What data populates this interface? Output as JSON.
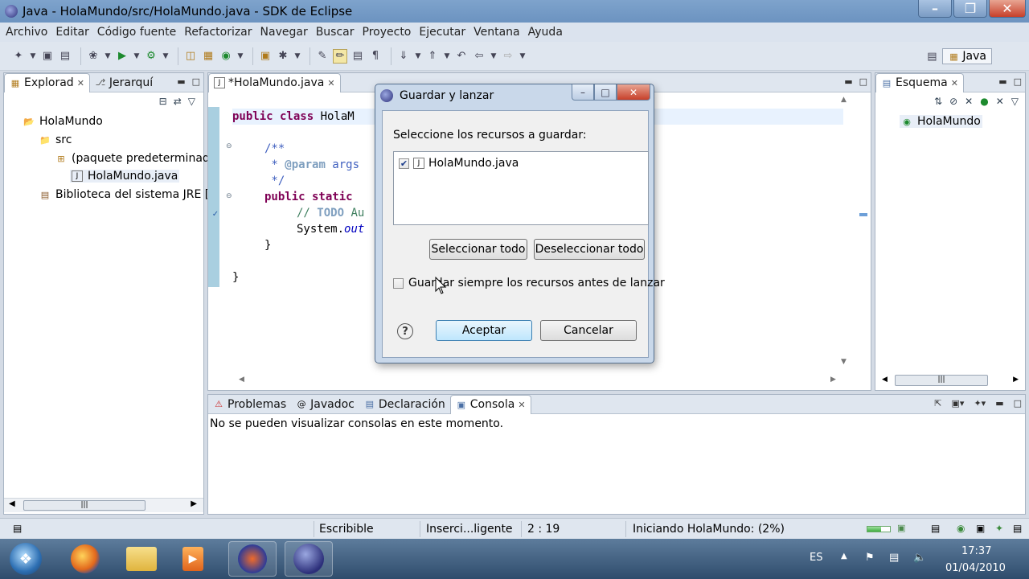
{
  "window": {
    "title": "Java - HolaMundo/src/HolaMundo.java - SDK de Eclipse"
  },
  "menu": [
    "Archivo",
    "Editar",
    "Código fuente",
    "Refactorizar",
    "Navegar",
    "Buscar",
    "Proyecto",
    "Ejecutar",
    "Ventana",
    "Ayuda"
  ],
  "perspective": {
    "label": "Java"
  },
  "explorer": {
    "tabs": [
      "Explorad",
      "Jerarquí"
    ],
    "tree": [
      "HolaMundo",
      "src",
      "(paquete predeterminad",
      "HolaMundo.java",
      "Biblioteca del sistema JRE ["
    ]
  },
  "editor": {
    "tab": "*HolaMundo.java",
    "lines": {
      "l1_kw": "public class ",
      "l1_rest": "HolaM",
      "l2": "/**",
      "l3a": " * ",
      "l3tag": "@param",
      "l3b": " args",
      "l4": " */",
      "l5_kw": "public static ",
      "l6a": "// ",
      "l6tag": "TODO",
      "l6b": " Au",
      "l7a": "System.",
      "l7b": "out",
      "l8": "}",
      "l9": "}"
    }
  },
  "outline": {
    "tab": "Esquema",
    "item": "HolaMundo"
  },
  "dialog": {
    "title": "Guardar y lanzar",
    "prompt": "Seleccione los recursos a guardar:",
    "resource": "HolaMundo.java",
    "resource_checked": true,
    "select_all": "Seleccionar todo",
    "deselect_all": "Deseleccionar todo",
    "always_save": "Guardar siempre los recursos antes de lanzar",
    "always_save_checked": false,
    "ok": "Aceptar",
    "cancel": "Cancelar"
  },
  "bottom": {
    "tabs": [
      "Problemas",
      "Javadoc",
      "Declaración",
      "Consola"
    ],
    "message": "No se pueden visualizar consolas en este momento."
  },
  "status": {
    "writable": "Escribible",
    "insert_mode": "Inserci...ligente",
    "position": "2 : 19",
    "progress_text": "Iniciando HolaMundo: (2%)",
    "progress_value": 0.02
  },
  "taskbar": {
    "lang": "ES",
    "time": "17:37",
    "date": "01/04/2010"
  },
  "colors": {
    "keyword": "#7f0055",
    "javadoc": "#3f5fbf",
    "comment": "#3f7f5f",
    "titlebar": "#7ea3cc"
  }
}
